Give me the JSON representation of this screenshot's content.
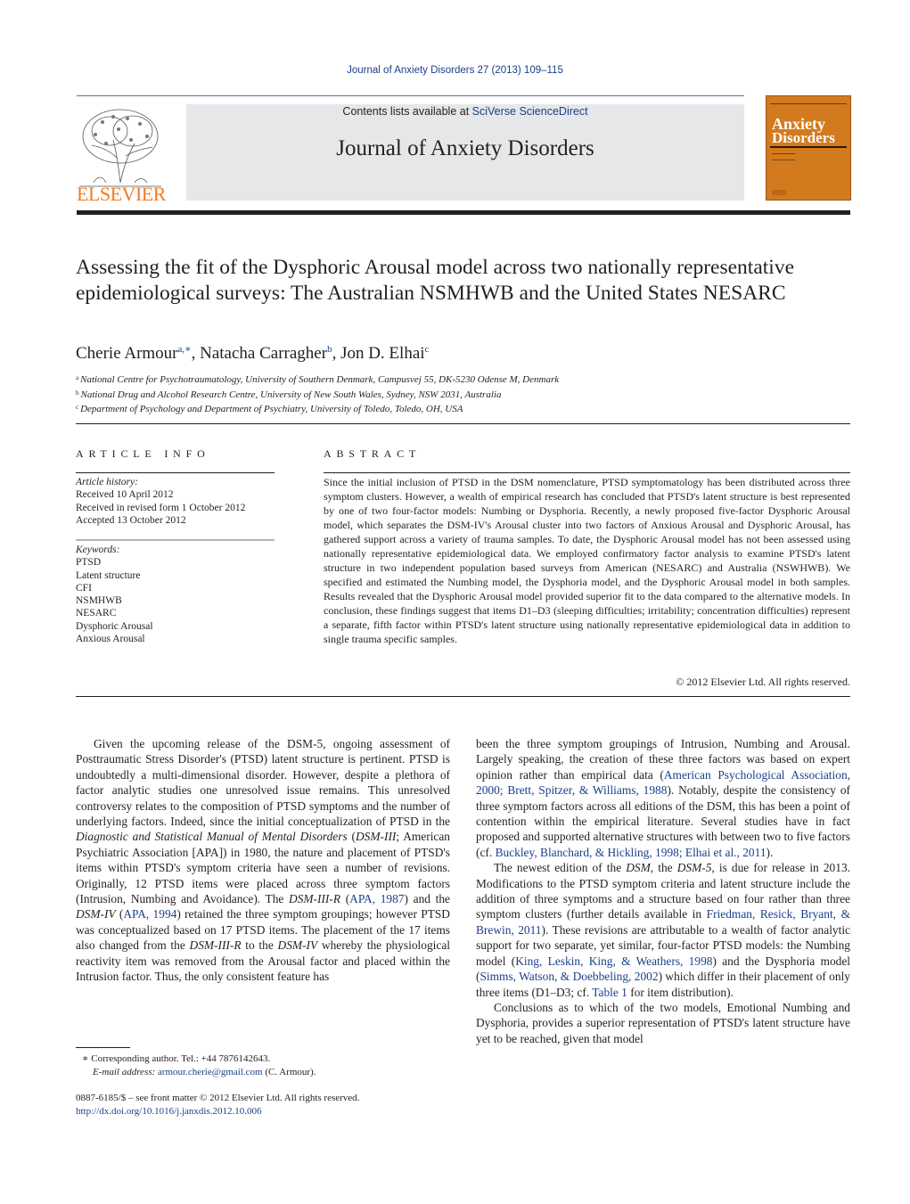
{
  "header": {
    "citation": "Journal of Anxiety Disorders 27 (2013) 109–115",
    "contents_prefix": "Contents lists available at ",
    "contents_link": "SciVerse ScienceDirect",
    "journal_name": "Journal of Anxiety Disorders",
    "publisher_logo_text": "ELSEVIER",
    "cover": {
      "title_line1": "Anxiety",
      "title_line2": "Disorders",
      "color": "#d47a1e"
    }
  },
  "article": {
    "title": "Assessing the fit of the Dysphoric Arousal model across two nationally representative epidemiological surveys: The Australian NSMHWB and the United States NESARC",
    "authors": [
      {
        "name": "Cherie Armour",
        "sup": "a,∗"
      },
      {
        "name": "Natacha Carragher",
        "sup": "b"
      },
      {
        "name": "Jon D. Elhai",
        "sup": "c"
      }
    ],
    "affiliations": [
      {
        "key": "a",
        "text": "National Centre for Psychotraumatology, University of Southern Denmark, Campusvej 55, DK-5230 Odense M, Denmark"
      },
      {
        "key": "b",
        "text": "National Drug and Alcohol Research Centre, University of New South Wales, Sydney, NSW 2031, Australia"
      },
      {
        "key": "c",
        "text": "Department of Psychology and Department of Psychiatry, University of Toledo, Toledo, OH, USA"
      }
    ]
  },
  "article_info": {
    "heading": "ARTICLE INFO",
    "history_label": "Article history:",
    "history": [
      "Received 10 April 2012",
      "Received in revised form 1 October 2012",
      "Accepted 13 October 2012"
    ],
    "keywords_label": "Keywords:",
    "keywords": [
      "PTSD",
      "Latent structure",
      "CFI",
      "NSMHWB",
      "NESARC",
      "Dysphoric Arousal",
      "Anxious Arousal"
    ]
  },
  "abstract": {
    "heading": "ABSTRACT",
    "text": "Since the initial inclusion of PTSD in the DSM nomenclature, PTSD symptomatology has been distributed across three symptom clusters. However, a wealth of empirical research has concluded that PTSD's latent structure is best represented by one of two four-factor models: Numbing or Dysphoria. Recently, a newly proposed five-factor Dysphoric Arousal model, which separates the DSM-IV's Arousal cluster into two factors of Anxious Arousal and Dysphoric Arousal, has gathered support across a variety of trauma samples. To date, the Dysphoric Arousal model has not been assessed using nationally representative epidemiological data. We employed confirmatory factor analysis to examine PTSD's latent structure in two independent population based surveys from American (NESARC) and Australia (NSWHWB). We specified and estimated the Numbing model, the Dysphoria model, and the Dysphoric Arousal model in both samples. Results revealed that the Dysphoric Arousal model provided superior fit to the data compared to the alternative models. In conclusion, these findings suggest that items D1–D3 (sleeping difficulties; irritability; concentration difficulties) represent a separate, fifth factor within PTSD's latent structure using nationally representative epidemiological data in addition to single trauma specific samples.",
    "copyright": "© 2012 Elsevier Ltd. All rights reserved."
  },
  "body": {
    "left": {
      "p1_a": "Given the upcoming release of the DSM-5, ongoing assessment of Posttraumatic Stress Disorder's (PTSD) latent structure is pertinent. PTSD is undoubtedly a multi-dimensional disorder. However, despite a plethora of factor analytic studies one unresolved issue remains. This unresolved controversy relates to the composition of PTSD symptoms and the number of underlying factors. Indeed, since the initial conceptualization of PTSD in the ",
      "p1_i1": "Diagnostic and Statistical Manual of Mental Disorders",
      "p1_b": " (",
      "p1_i2": "DSM-III",
      "p1_c": "; American Psychiatric Association [APA]) in 1980, the nature and placement of PTSD's items within PTSD's symptom criteria have seen a number of revisions. Originally, 12 PTSD items were placed across three symptom factors (Intrusion, Numbing and Avoidance). The ",
      "p1_i3": "DSM-III-R",
      "p1_d": " (",
      "p1_link1": "APA, 1987",
      "p1_e": ") and the ",
      "p1_i4": "DSM-IV",
      "p1_f": " (",
      "p1_link2": "APA, 1994",
      "p1_g": ") retained the three symptom groupings; however PTSD was conceptualized based on 17 PTSD items. The placement of the 17 items also changed from the ",
      "p1_i5": "DSM-III-R",
      "p1_h": " to the ",
      "p1_i6": "DSM-IV",
      "p1_j": " whereby the physiological reactivity item was removed from the Arousal factor and placed within the Intrusion factor. Thus, the only consistent feature has"
    },
    "right": {
      "p1_a": "been the three symptom groupings of Intrusion, Numbing and Arousal. Largely speaking, the creation of these three factors was based on expert opinion rather than empirical data (",
      "p1_link1": "American Psychological Association, 2000; Brett, Spitzer, & Williams, 1988",
      "p1_b": "). Notably, despite the consistency of three symptom factors across all editions of the DSM, this has been a point of contention within the empirical literature. Several studies have in fact proposed and supported alternative structures with between two to five factors (cf. ",
      "p1_link2": "Buckley, Blanchard, & Hickling, 1998; Elhai et al., 2011",
      "p1_c": ").",
      "p2_a": "The newest edition of the ",
      "p2_i1": "DSM",
      "p2_b": ", the ",
      "p2_i2": "DSM-5",
      "p2_c": ", is due for release in 2013. Modifications to the PTSD symptom criteria and latent structure include the addition of three symptoms and a structure based on four rather than three symptom clusters (further details available in ",
      "p2_link1": "Friedman, Resick, Bryant, & Brewin, 2011",
      "p2_d": "). These revisions are attributable to a wealth of factor analytic support for two separate, yet similar, four-factor PTSD models: the Numbing model (",
      "p2_link2": "King, Leskin, King, & Weathers, 1998",
      "p2_e": ") and the Dysphoria model (",
      "p2_link3": "Simms, Watson, & Doebbeling, 2002",
      "p2_f": ") which differ in their placement of only three items (D1–D3; cf. ",
      "p2_link4": "Table 1",
      "p2_g": " for item distribution).",
      "p3": "Conclusions as to which of the two models, Emotional Numbing and Dysphoria, provides a superior representation of PTSD's latent structure have yet to be reached, given that model"
    }
  },
  "footnotes": {
    "star": "∗",
    "corresponding": "Corresponding author. Tel.: +44 7876142643.",
    "email_label": "E-mail address:",
    "email": "armour.cherie@gmail.com",
    "email_suffix": " (C. Armour).",
    "front_matter": "0887-6185/$ – see front matter © 2012 Elsevier Ltd. All rights reserved.",
    "doi": "http://dx.doi.org/10.1016/j.janxdis.2012.10.006"
  }
}
